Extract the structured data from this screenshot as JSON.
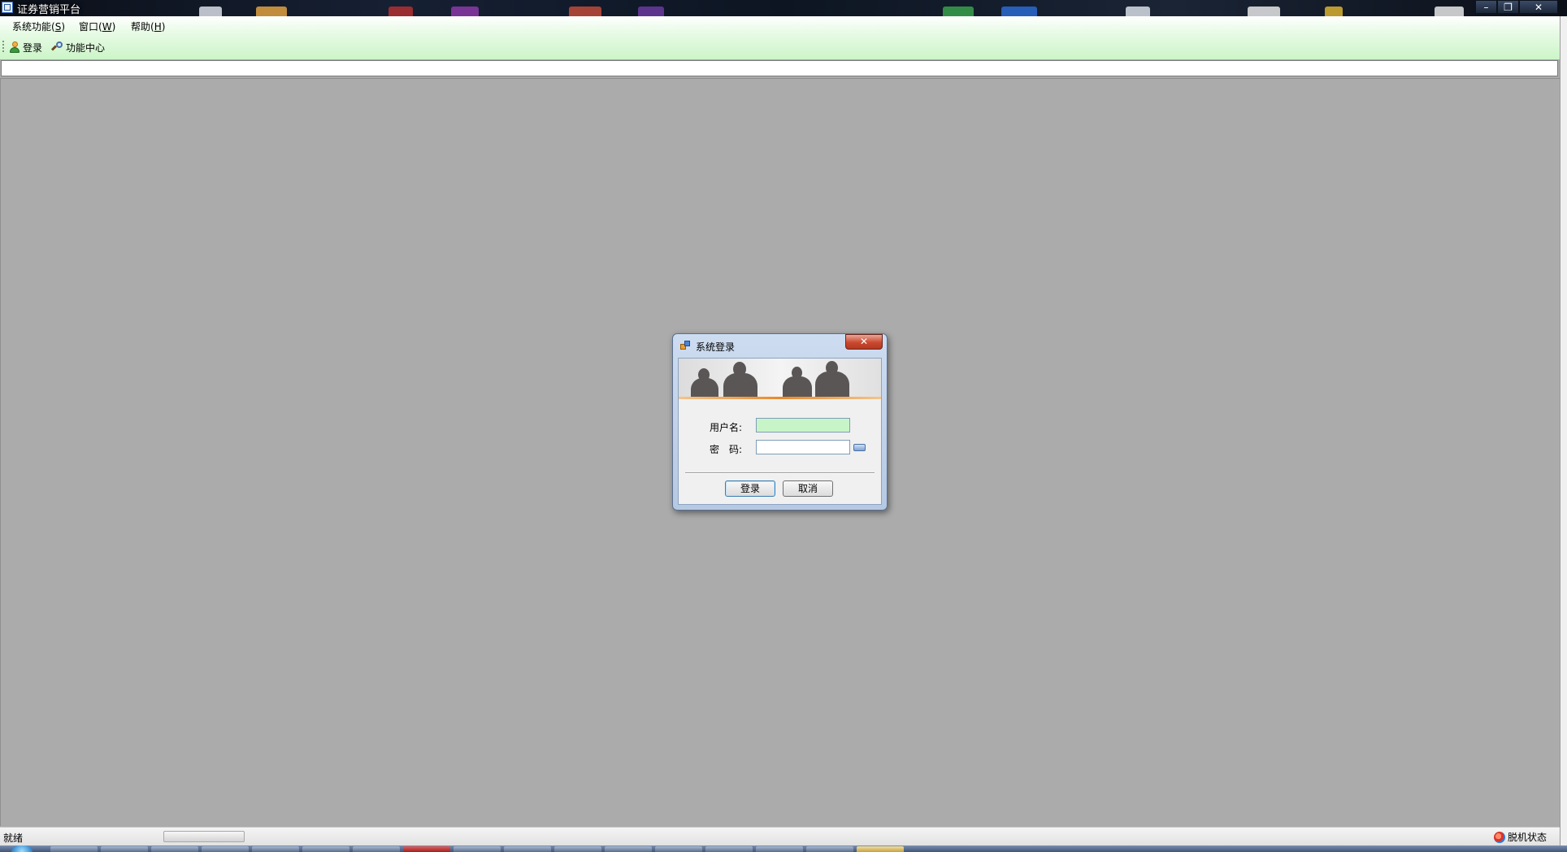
{
  "window": {
    "title": "证券营销平台",
    "controls": {
      "minimize": "–",
      "restore": "❐",
      "close": "✕"
    }
  },
  "menubar": {
    "items": [
      {
        "label": "系统功能(",
        "key": "S",
        "end": ")"
      },
      {
        "label": "窗口(",
        "key": "W",
        "end": ")"
      },
      {
        "label": "帮助(",
        "key": "H",
        "end": ")"
      }
    ]
  },
  "toolbar": {
    "login_label": "登录",
    "login_icon": "user-icon",
    "function_center_label": "功能中心",
    "function_center_icon": "magnifier-icon"
  },
  "address": {
    "value": ""
  },
  "statusbar": {
    "status_text": "就绪",
    "connection_text": "脱机状态",
    "connection_icon": "globe-icon"
  },
  "login_dialog": {
    "title": "系统登录",
    "close_glyph": "✕",
    "username_label": "用户名:",
    "username_value": "",
    "password_label": "密　码:",
    "password_value": "",
    "login_button": "登录",
    "cancel_button": "取消"
  },
  "colors": {
    "mdi_background": "#ababab",
    "toolbar_gradient_end": "#ccf5c8",
    "active_field": "#c8f5c8",
    "dialog_frame": "#b6c9e3"
  }
}
